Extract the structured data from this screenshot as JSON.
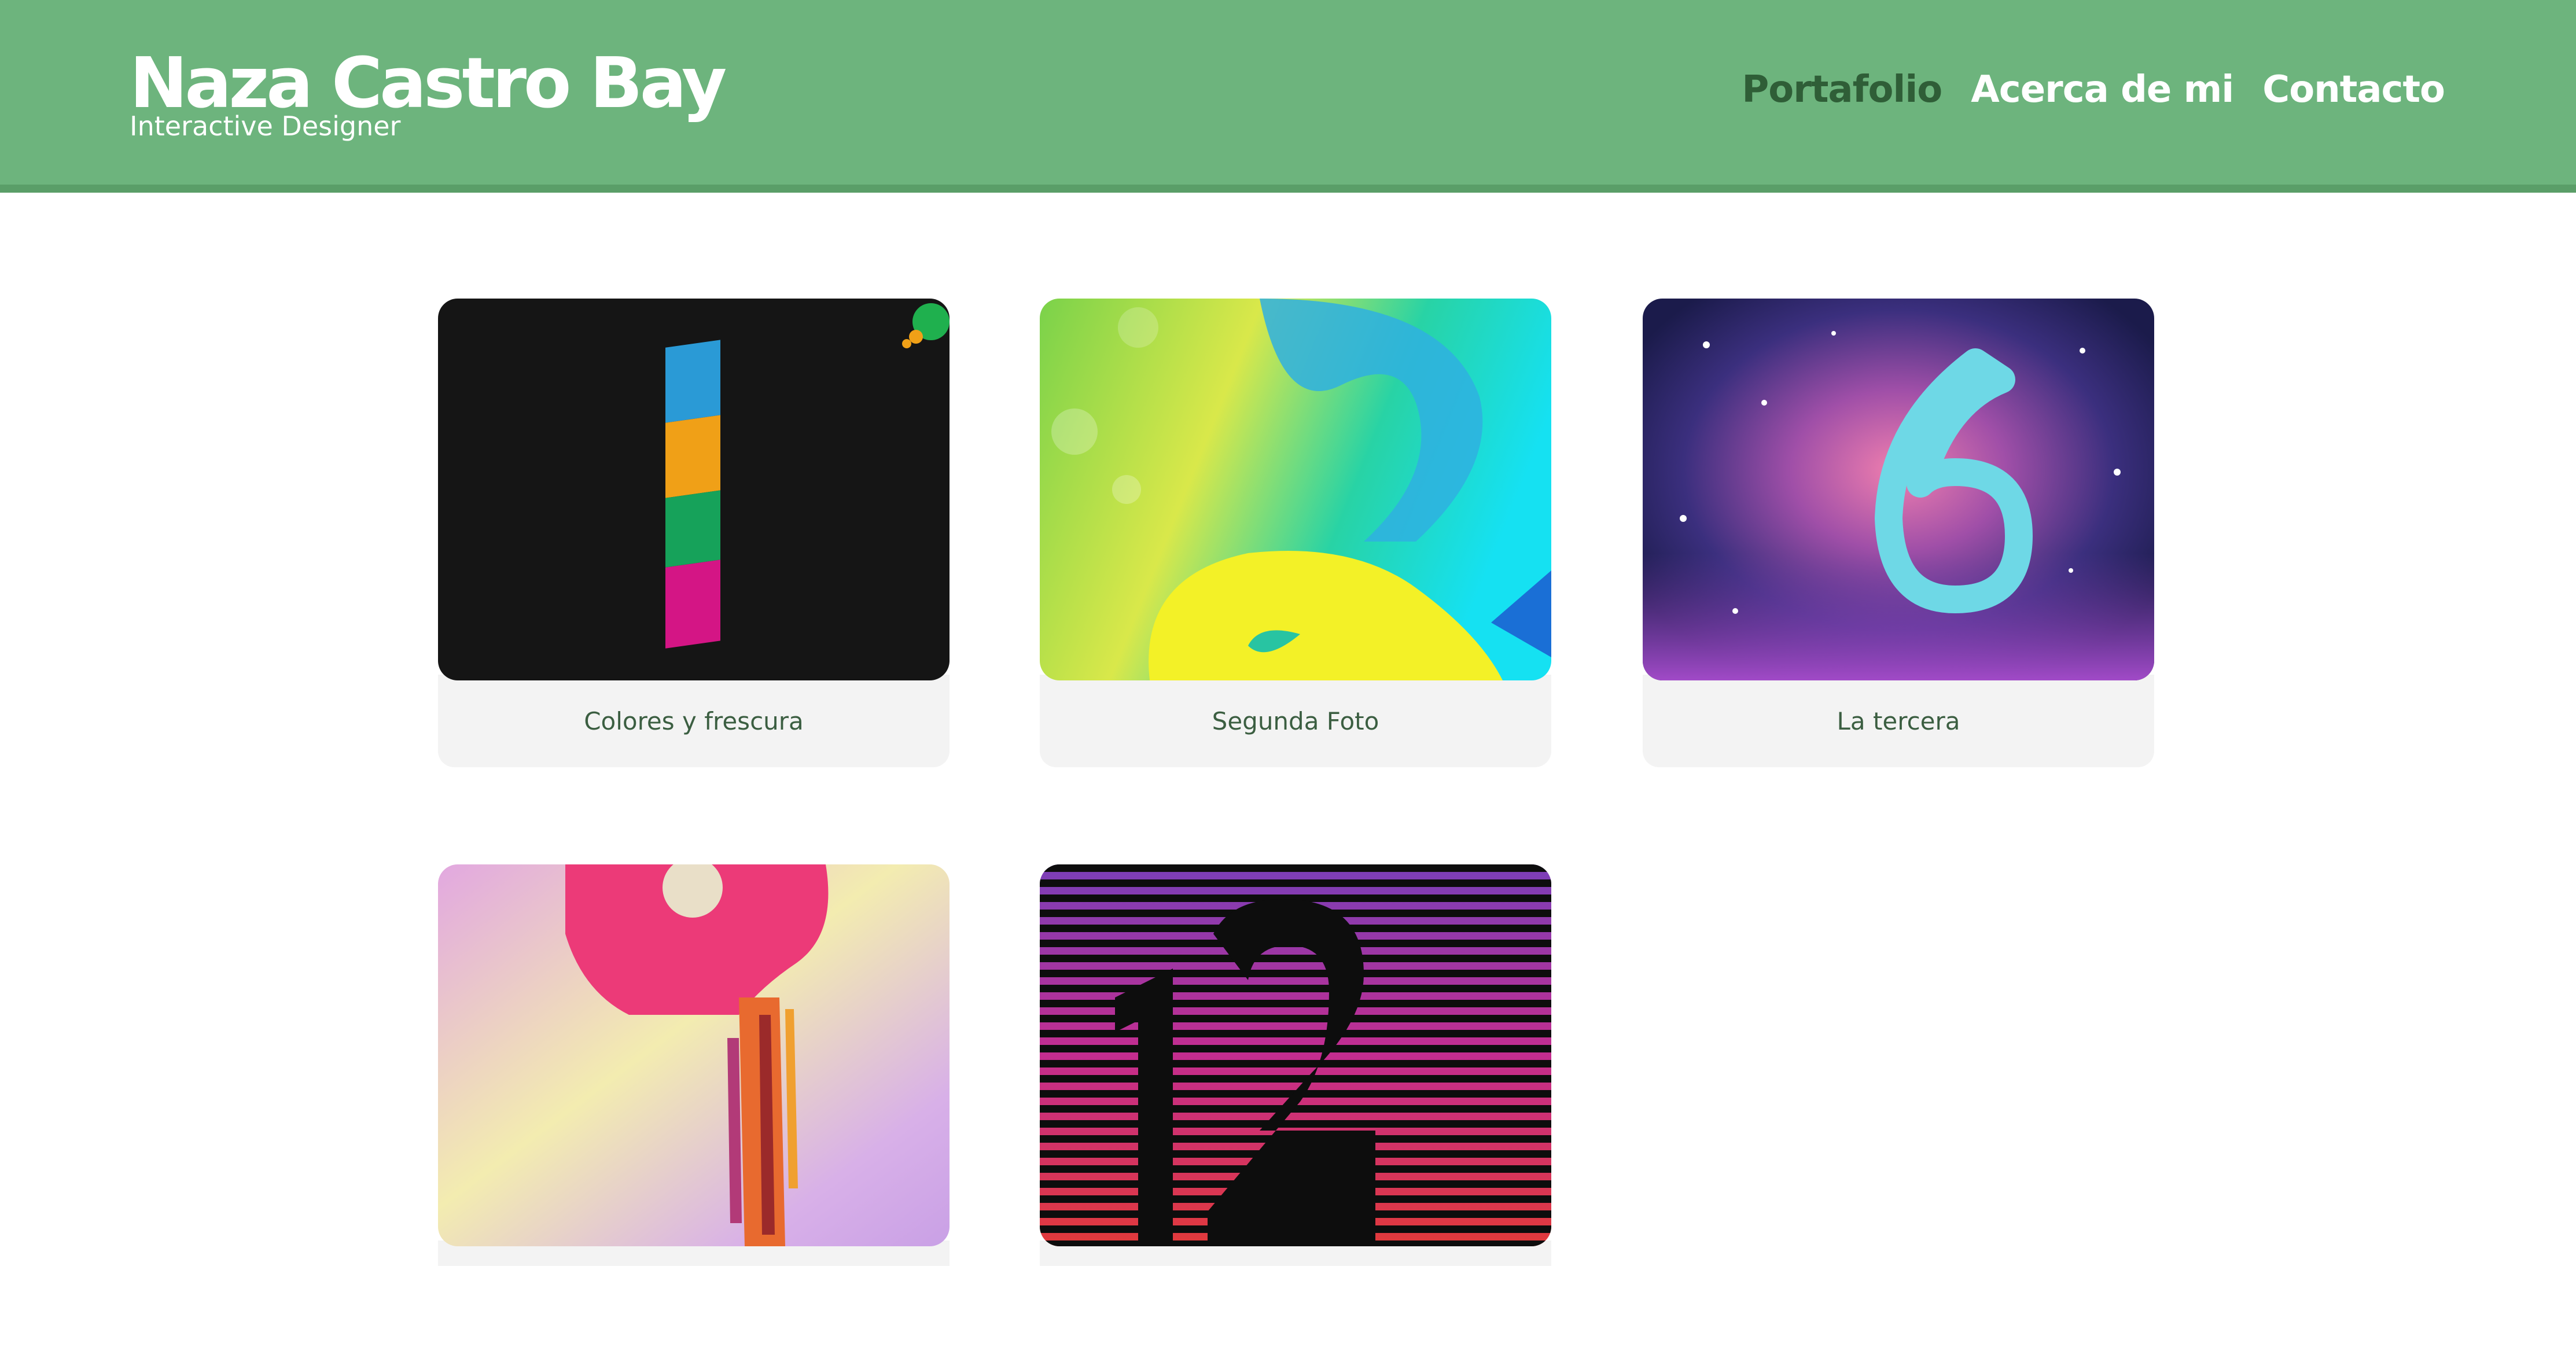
{
  "brand": {
    "name": "Naza Castro Bay",
    "subtitle": "Interactive Designer"
  },
  "nav": [
    {
      "label": "Portafolio",
      "active": true
    },
    {
      "label": "Acerca de mi",
      "active": false
    },
    {
      "label": "Contacto",
      "active": false
    }
  ],
  "portfolio": [
    {
      "title": "Colores y frescura",
      "artwork": "number-1-artwork"
    },
    {
      "title": "Segunda Foto",
      "artwork": "number-3-artwork"
    },
    {
      "title": "La tercera",
      "artwork": "number-6-artwork"
    },
    {
      "title": "",
      "artwork": "number-9-artwork"
    },
    {
      "title": "",
      "artwork": "number-12-artwork"
    }
  ],
  "colors": {
    "header": "#6db47d",
    "nav_active": "#2f5e37",
    "caption_text": "#3b5e41"
  }
}
